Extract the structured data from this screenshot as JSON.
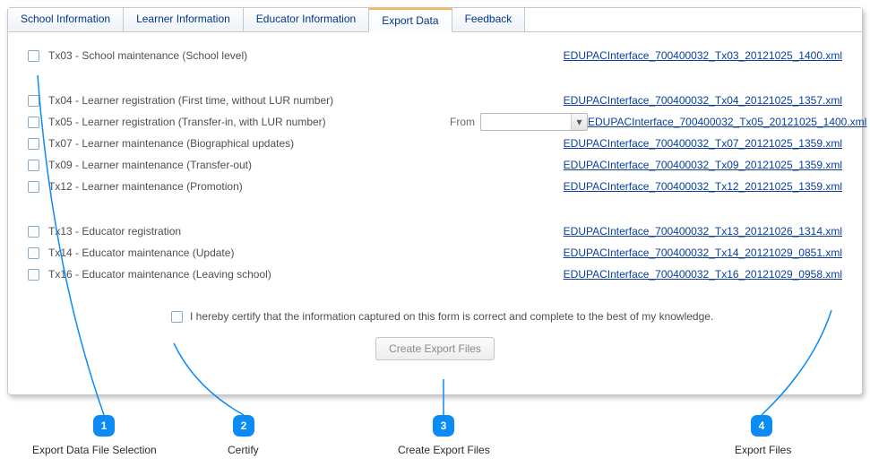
{
  "tabs": [
    "School Information",
    "Learner Information",
    "Educator Information",
    "Export Data",
    "Feedback"
  ],
  "active_tab": 3,
  "groups": [
    [
      {
        "label": "Tx03 - School maintenance (School level)",
        "link": "EDUPACInterface_700400032_Tx03_20121025_1400.xml"
      }
    ],
    [
      {
        "label": "Tx04 - Learner registration (First time, without LUR number)",
        "link": "EDUPACInterface_700400032_Tx04_20121025_1357.xml"
      },
      {
        "label": "Tx05 - Learner registration (Transfer-in, with LUR number)",
        "link": "EDUPACInterface_700400032_Tx05_20121025_1400.xml",
        "from": true
      },
      {
        "label": "Tx07 - Learner maintenance (Biographical updates)",
        "link": "EDUPACInterface_700400032_Tx07_20121025_1359.xml"
      },
      {
        "label": "Tx09 - Learner maintenance (Transfer-out)",
        "link": "EDUPACInterface_700400032_Tx09_20121025_1359.xml"
      },
      {
        "label": "Tx12 - Learner maintenance (Promotion)",
        "link": "EDUPACInterface_700400032_Tx12_20121025_1359.xml"
      }
    ],
    [
      {
        "label": "Tx13 - Educator registration",
        "link": "EDUPACInterface_700400032_Tx13_20121026_1314.xml"
      },
      {
        "label": "Tx14 - Educator maintenance (Update)",
        "link": "EDUPACInterface_700400032_Tx14_20121029_0851.xml"
      },
      {
        "label": "Tx16 - Educator maintenance (Leaving school)",
        "link": "EDUPACInterface_700400032_Tx16_20121029_0958.xml"
      }
    ]
  ],
  "from_label": "From",
  "from_value": "",
  "certify_text": "I hereby certify that the information captured on this form is correct and complete to the best of my knowledge.",
  "create_button": "Create Export Files",
  "annotations": [
    {
      "num": "1",
      "label": "Export Data File Selection"
    },
    {
      "num": "2",
      "label": "Certify"
    },
    {
      "num": "3",
      "label": "Create Export Files"
    },
    {
      "num": "4",
      "label": "Export Files"
    }
  ]
}
